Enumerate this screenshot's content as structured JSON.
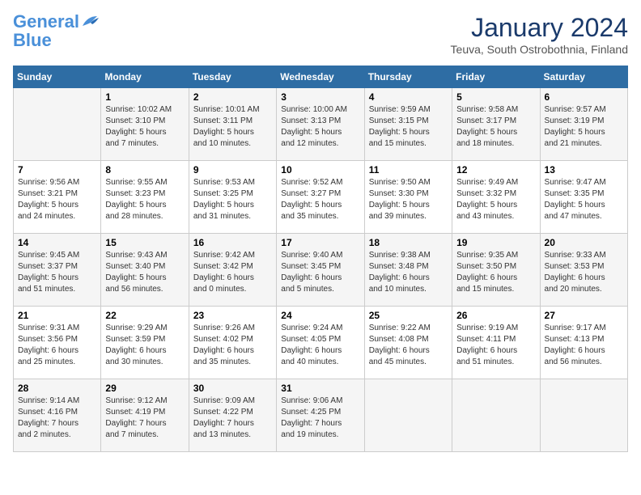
{
  "header": {
    "logo_line1": "General",
    "logo_line2": "Blue",
    "month": "January 2024",
    "location": "Teuva, South Ostrobothnia, Finland"
  },
  "columns": [
    "Sunday",
    "Monday",
    "Tuesday",
    "Wednesday",
    "Thursday",
    "Friday",
    "Saturday"
  ],
  "weeks": [
    [
      {
        "day": "",
        "info": ""
      },
      {
        "day": "1",
        "info": "Sunrise: 10:02 AM\nSunset: 3:10 PM\nDaylight: 5 hours\nand 7 minutes."
      },
      {
        "day": "2",
        "info": "Sunrise: 10:01 AM\nSunset: 3:11 PM\nDaylight: 5 hours\nand 10 minutes."
      },
      {
        "day": "3",
        "info": "Sunrise: 10:00 AM\nSunset: 3:13 PM\nDaylight: 5 hours\nand 12 minutes."
      },
      {
        "day": "4",
        "info": "Sunrise: 9:59 AM\nSunset: 3:15 PM\nDaylight: 5 hours\nand 15 minutes."
      },
      {
        "day": "5",
        "info": "Sunrise: 9:58 AM\nSunset: 3:17 PM\nDaylight: 5 hours\nand 18 minutes."
      },
      {
        "day": "6",
        "info": "Sunrise: 9:57 AM\nSunset: 3:19 PM\nDaylight: 5 hours\nand 21 minutes."
      }
    ],
    [
      {
        "day": "7",
        "info": "Sunrise: 9:56 AM\nSunset: 3:21 PM\nDaylight: 5 hours\nand 24 minutes."
      },
      {
        "day": "8",
        "info": "Sunrise: 9:55 AM\nSunset: 3:23 PM\nDaylight: 5 hours\nand 28 minutes."
      },
      {
        "day": "9",
        "info": "Sunrise: 9:53 AM\nSunset: 3:25 PM\nDaylight: 5 hours\nand 31 minutes."
      },
      {
        "day": "10",
        "info": "Sunrise: 9:52 AM\nSunset: 3:27 PM\nDaylight: 5 hours\nand 35 minutes."
      },
      {
        "day": "11",
        "info": "Sunrise: 9:50 AM\nSunset: 3:30 PM\nDaylight: 5 hours\nand 39 minutes."
      },
      {
        "day": "12",
        "info": "Sunrise: 9:49 AM\nSunset: 3:32 PM\nDaylight: 5 hours\nand 43 minutes."
      },
      {
        "day": "13",
        "info": "Sunrise: 9:47 AM\nSunset: 3:35 PM\nDaylight: 5 hours\nand 47 minutes."
      }
    ],
    [
      {
        "day": "14",
        "info": "Sunrise: 9:45 AM\nSunset: 3:37 PM\nDaylight: 5 hours\nand 51 minutes."
      },
      {
        "day": "15",
        "info": "Sunrise: 9:43 AM\nSunset: 3:40 PM\nDaylight: 5 hours\nand 56 minutes."
      },
      {
        "day": "16",
        "info": "Sunrise: 9:42 AM\nSunset: 3:42 PM\nDaylight: 6 hours\nand 0 minutes."
      },
      {
        "day": "17",
        "info": "Sunrise: 9:40 AM\nSunset: 3:45 PM\nDaylight: 6 hours\nand 5 minutes."
      },
      {
        "day": "18",
        "info": "Sunrise: 9:38 AM\nSunset: 3:48 PM\nDaylight: 6 hours\nand 10 minutes."
      },
      {
        "day": "19",
        "info": "Sunrise: 9:35 AM\nSunset: 3:50 PM\nDaylight: 6 hours\nand 15 minutes."
      },
      {
        "day": "20",
        "info": "Sunrise: 9:33 AM\nSunset: 3:53 PM\nDaylight: 6 hours\nand 20 minutes."
      }
    ],
    [
      {
        "day": "21",
        "info": "Sunrise: 9:31 AM\nSunset: 3:56 PM\nDaylight: 6 hours\nand 25 minutes."
      },
      {
        "day": "22",
        "info": "Sunrise: 9:29 AM\nSunset: 3:59 PM\nDaylight: 6 hours\nand 30 minutes."
      },
      {
        "day": "23",
        "info": "Sunrise: 9:26 AM\nSunset: 4:02 PM\nDaylight: 6 hours\nand 35 minutes."
      },
      {
        "day": "24",
        "info": "Sunrise: 9:24 AM\nSunset: 4:05 PM\nDaylight: 6 hours\nand 40 minutes."
      },
      {
        "day": "25",
        "info": "Sunrise: 9:22 AM\nSunset: 4:08 PM\nDaylight: 6 hours\nand 45 minutes."
      },
      {
        "day": "26",
        "info": "Sunrise: 9:19 AM\nSunset: 4:11 PM\nDaylight: 6 hours\nand 51 minutes."
      },
      {
        "day": "27",
        "info": "Sunrise: 9:17 AM\nSunset: 4:13 PM\nDaylight: 6 hours\nand 56 minutes."
      }
    ],
    [
      {
        "day": "28",
        "info": "Sunrise: 9:14 AM\nSunset: 4:16 PM\nDaylight: 7 hours\nand 2 minutes."
      },
      {
        "day": "29",
        "info": "Sunrise: 9:12 AM\nSunset: 4:19 PM\nDaylight: 7 hours\nand 7 minutes."
      },
      {
        "day": "30",
        "info": "Sunrise: 9:09 AM\nSunset: 4:22 PM\nDaylight: 7 hours\nand 13 minutes."
      },
      {
        "day": "31",
        "info": "Sunrise: 9:06 AM\nSunset: 4:25 PM\nDaylight: 7 hours\nand 19 minutes."
      },
      {
        "day": "",
        "info": ""
      },
      {
        "day": "",
        "info": ""
      },
      {
        "day": "",
        "info": ""
      }
    ]
  ]
}
